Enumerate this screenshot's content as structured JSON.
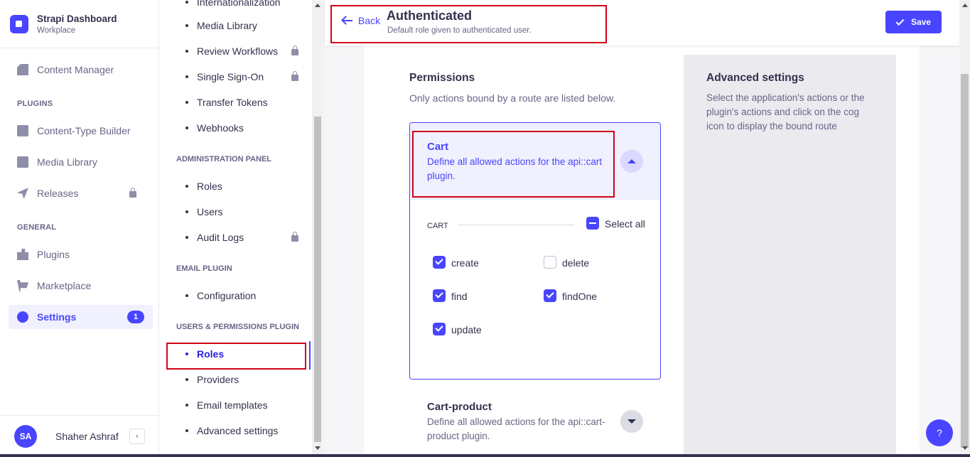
{
  "brand": {
    "title": "Strapi Dashboard",
    "subtitle": "Workplace"
  },
  "main_nav": {
    "content_manager": "Content Manager",
    "plugins_heading": "PLUGINS",
    "content_type_builder": "Content-Type Builder",
    "media_library": "Media Library",
    "releases": "Releases",
    "general_heading": "GENERAL",
    "plugins": "Plugins",
    "marketplace": "Marketplace",
    "settings": "Settings",
    "settings_badge": "1"
  },
  "user": {
    "initials": "SA",
    "name": "Shaher Ashraf"
  },
  "sub_nav": {
    "top_items": [
      "Internationalization",
      "Media Library",
      "Review Workflows",
      "Single Sign-On",
      "Transfer Tokens",
      "Webhooks"
    ],
    "admin_heading": "ADMINISTRATION PANEL",
    "admin_items": [
      "Roles",
      "Users",
      "Audit Logs"
    ],
    "email_heading": "EMAIL PLUGIN",
    "email_items": [
      "Configuration"
    ],
    "users_heading": "USERS & PERMISSIONS PLUGIN",
    "users_items": [
      "Roles",
      "Providers",
      "Email templates",
      "Advanced settings"
    ]
  },
  "header": {
    "back_label": "Back",
    "title": "Authenticated",
    "subtitle": "Default role given to authenticated user.",
    "save_label": "Save"
  },
  "permissions": {
    "title": "Permissions",
    "subtitle": "Only actions bound by a route are listed below.",
    "cart": {
      "title": "Cart",
      "description": "Define all allowed actions for the api::cart plugin.",
      "group_label": "CART",
      "select_all_label": "Select all",
      "actions": [
        {
          "label": "create",
          "checked": true
        },
        {
          "label": "delete",
          "checked": false
        },
        {
          "label": "find",
          "checked": true
        },
        {
          "label": "findOne",
          "checked": true
        },
        {
          "label": "update",
          "checked": true
        }
      ]
    },
    "cart_product": {
      "title": "Cart-product",
      "description": "Define all allowed actions for the api::cart-product plugin."
    }
  },
  "advanced": {
    "title": "Advanced settings",
    "description": "Select the application's actions or the plugin's actions and click on the cog icon to display the bound route"
  },
  "help_label": "?",
  "colors": {
    "accent": "#4945ff",
    "annotation": "#d0021b"
  }
}
